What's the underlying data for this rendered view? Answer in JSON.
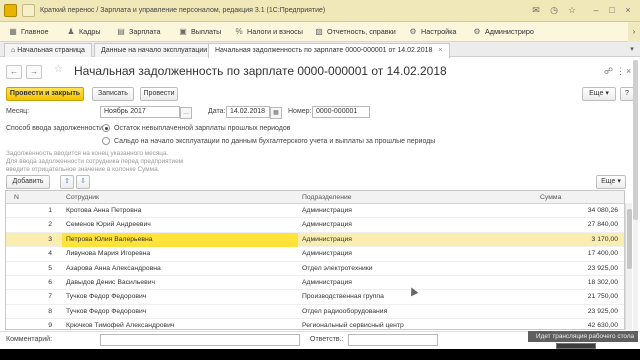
{
  "window": {
    "title": "Краткий перенос / Зарплата и управление персоналом, редакция 3.1  (1С:Предприятие)"
  },
  "menu": {
    "items": [
      {
        "icon": "grid-icon",
        "label": "Главное"
      },
      {
        "icon": "people-icon",
        "label": "Кадры"
      },
      {
        "icon": "wallet-icon",
        "label": "Зарплата"
      },
      {
        "icon": "payments-icon",
        "label": "Выплаты"
      },
      {
        "icon": "percent-icon",
        "label": "Налоги и взносы"
      },
      {
        "icon": "reports-icon",
        "label": "Отчетность, справки"
      },
      {
        "icon": "gear-icon",
        "label": "Настройка"
      },
      {
        "icon": "admin-icon",
        "label": "Администриро"
      }
    ]
  },
  "tabs": [
    {
      "label": "Начальная страница"
    },
    {
      "label": "Данные на начало эксплуатации"
    },
    {
      "label": "Начальная задолженность по зарплате 0000-000001 от 14.02.2018"
    }
  ],
  "form": {
    "title": "Начальная задолженность по зарплате 0000-000001 от 14.02.2018",
    "buttons": {
      "post_and_close": "Провести и закрыть",
      "save": "Записать",
      "post": "Провести",
      "more": "Еще"
    },
    "fields": {
      "month_label": "Месяц:",
      "month_value": "Ноябрь 2017",
      "date_label": "Дата:",
      "date_value": "14.02.2018",
      "number_label": "Номер:",
      "number_value": "0000-000001"
    },
    "method": {
      "label": "Способ ввода задолженности:",
      "option1": "Остаток невыплаченной зарплаты прошлых периодов",
      "option2": "Сальдо на начало эксплуатации по данным бухгалтерского учета и выплаты за прошлые периоды",
      "selected": 1
    },
    "hint": {
      "line1": "Задолженность вводится на конец указанного месяца.",
      "line2": "Для ввода задолженности сотрудника перед предприятием",
      "line3": "введите отрицательное значение в колонке Сумма."
    },
    "table_bar": {
      "add": "Добавить",
      "more": "Еще"
    },
    "table": {
      "columns": {
        "n": "N",
        "employee": "Сотрудник",
        "department": "Подразделение",
        "amount": "Сумма"
      },
      "rows": [
        {
          "n": "1",
          "employee": "Кротова Анна Петровна",
          "department": "Администрация",
          "amount": "34 080,26"
        },
        {
          "n": "2",
          "employee": "Семенов Юрий Андреевич",
          "department": "Администрация",
          "amount": "27 840,00"
        },
        {
          "n": "3",
          "employee": "Петрова Юлия Валерьевна",
          "department": "Администрация",
          "amount": "3 170,00"
        },
        {
          "n": "4",
          "employee": "Ливунова Мария Игоревна",
          "department": "Администрация",
          "amount": "17 400,00"
        },
        {
          "n": "5",
          "employee": "Азарова Анна Александровна",
          "department": "Отдел электротехники",
          "amount": "23 925,00"
        },
        {
          "n": "6",
          "employee": "Давыдов Денис Васильевич",
          "department": "Администрация",
          "amount": "18 302,00"
        },
        {
          "n": "7",
          "employee": "Тучков Федор Федорович",
          "department": "Производственная группа",
          "amount": "21 750,00"
        },
        {
          "n": "8",
          "employee": "Тучков Федор Федорович",
          "department": "Отдел радиооборудования",
          "amount": "23 925,00"
        },
        {
          "n": "9",
          "employee": "Крючков Тимофей Александрович",
          "department": "Региональный сервисный центр",
          "amount": "42 630,00"
        }
      ],
      "selected_row": 2
    },
    "footer": {
      "comment_label": "Комментарий:",
      "responsible_label": "Ответств.:"
    }
  },
  "tooltip": "Идет трансляция рабочего стола",
  "colors": {
    "titlebar": "#f0e8b8",
    "primary_button": "#f2c200",
    "selected_row": "#f9eeb0"
  }
}
